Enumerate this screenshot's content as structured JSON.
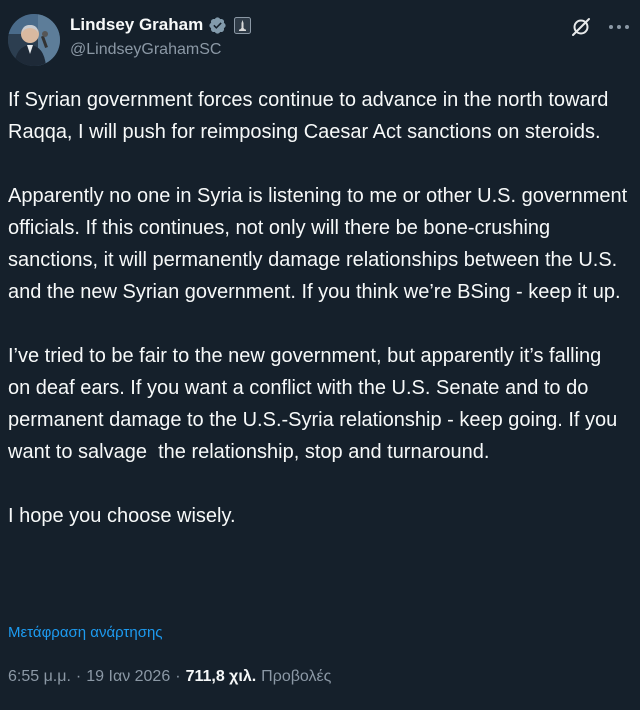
{
  "author": {
    "display_name": "Lindsey Graham",
    "handle": "@LindseyGrahamSC"
  },
  "icons": {
    "verified": "verified-badge-icon",
    "affiliation": "government-affiliation-icon",
    "grok": "grok-icon",
    "more": "more-options-icon"
  },
  "colors": {
    "background": "#15202b",
    "text": "#f7f9f9",
    "secondary": "#8b98a5",
    "accent": "#1d9bf0",
    "verified_badge": "#829aab"
  },
  "tweet": {
    "paragraphs": [
      "If Syrian government forces continue to advance in the north toward Raqqa, I will push for reimposing Caesar Act sanctions on steroids.",
      "Apparently no one in Syria is listening to me or other U.S. government officials. If this continues, not only will there be bone-crushing sanctions, it will permanently damage relationships between the U.S. and the new Syrian government. If you think we’re BSing - keep it up.",
      "I’ve tried to be fair to the new government, but apparently it’s falling on deaf ears. If you want a conflict with the U.S. Senate and to do permanent damage to the U.S.-Syria relationship - keep going. If you want to salvage  the relationship, stop and turnaround.",
      "I hope you choose wisely."
    ],
    "translate_label": "Μετάφραση ανάρτησης"
  },
  "meta": {
    "time": "6:55 μ.μ.",
    "separator": "·",
    "date": "19 Ιαν 2026",
    "views_count": "711,8 χιλ.",
    "views_label": "Προβολές"
  }
}
